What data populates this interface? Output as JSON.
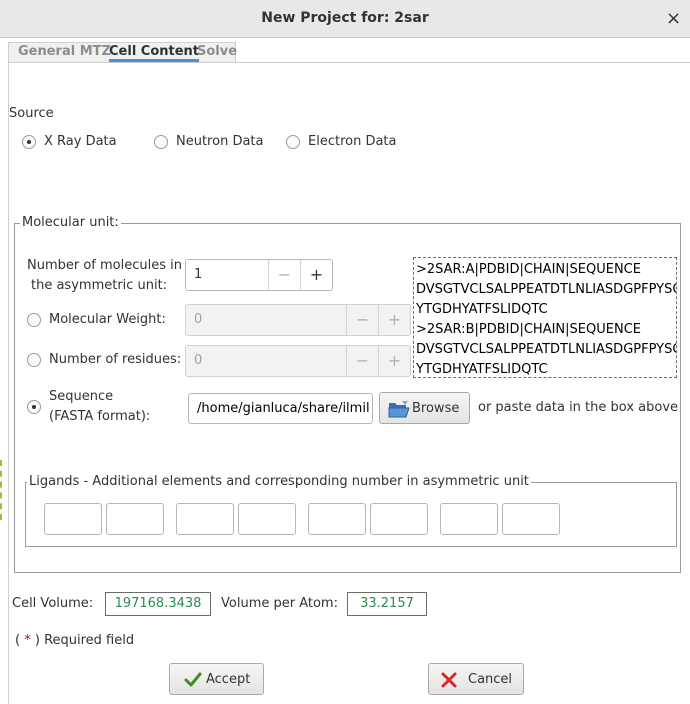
{
  "window": {
    "title": "New Project for: 2sar",
    "close_glyph": "×"
  },
  "tabs": [
    {
      "label": "General MTZ",
      "active": false
    },
    {
      "label": "Cell Content",
      "active": true
    },
    {
      "label": "Solve",
      "active": false
    }
  ],
  "source": {
    "label": "Source",
    "options": [
      {
        "label": "X Ray Data",
        "checked": true
      },
      {
        "label": "Neutron Data",
        "checked": false
      },
      {
        "label": "Electron Data",
        "checked": false
      }
    ]
  },
  "molecular_unit": {
    "title": "Molecular unit:",
    "num_molecules_label_line1": "Number of molecules in",
    "num_molecules_label_line2": "the asymmetric unit:",
    "num_molecules_value": "1",
    "molecular_weight_label": "Molecular Weight:",
    "molecular_weight_value": "0",
    "num_residues_label": "Number of residues:",
    "num_residues_value": "0",
    "sequence_label_line1": "Sequence",
    "sequence_label_line2": "(FASTA format):",
    "sequence_path": "/home/gianluca/share/ilmil",
    "browse_label": "Browse",
    "paste_hint": "or paste data in the box above",
    "sequence_lines": [
      ">2SAR:A|PDBID|CHAIN|SEQUENCE",
      "DVSGTVCLSALPPEATDTLNLIASDGPFPYSQDG",
      "YTGDHYATFSLIDQTC",
      ">2SAR:B|PDBID|CHAIN|SEQUENCE",
      "DVSGTVCLSALPPEATDTLNLIASDGPFPYSQDG",
      "YTGDHYATFSLIDQTC"
    ],
    "radio_selected": "sequence"
  },
  "ligands": {
    "title": "Ligands - Additional elements and corresponding number in asymmetric unit"
  },
  "cell": {
    "volume_label": "Cell Volume:",
    "volume_value": "197168.3438",
    "vpa_label": "Volume per Atom:",
    "vpa_value": "33.2157"
  },
  "required": {
    "open": "(",
    "star": "*",
    "close": ") Required field"
  },
  "buttons": {
    "accept": "Accept",
    "cancel": "Cancel"
  },
  "colors": {
    "value_green": "#2a8a55",
    "accent_blue": "#4a90d9",
    "required_red": "#cc0000"
  }
}
